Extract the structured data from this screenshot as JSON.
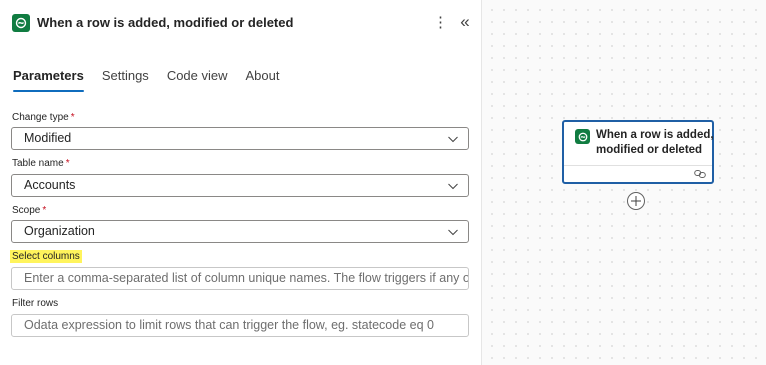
{
  "panel": {
    "title": "When a row is added, modified or deleted",
    "icon": "dataverse-icon",
    "more_icon": "⋮",
    "collapse_icon": "«"
  },
  "tabs": [
    {
      "label": "Parameters",
      "active": true
    },
    {
      "label": "Settings",
      "active": false
    },
    {
      "label": "Code view",
      "active": false
    },
    {
      "label": "About",
      "active": false
    }
  ],
  "fields": {
    "change_type": {
      "label": "Change type",
      "required": "*",
      "value": "Modified"
    },
    "table_name": {
      "label": "Table name",
      "required": "*",
      "value": "Accounts"
    },
    "scope": {
      "label": "Scope",
      "required": "*",
      "value": "Organization"
    },
    "select_columns": {
      "label": "Select columns",
      "placeholder": "Enter a comma-separated list of column unique names. The flow triggers if any of them ar..."
    },
    "filter_rows": {
      "label": "Filter rows",
      "placeholder": "Odata expression to limit rows that can trigger the flow, eg. statecode eq 0"
    }
  },
  "canvas": {
    "card_title": "When a row is added, modified or deleted",
    "card_icon": "dataverse-icon",
    "link_icon": "link-icon",
    "add_icon": "plus-circle-icon"
  },
  "colors": {
    "accent": "#0f6cbd",
    "brand_green": "#107c41",
    "highlight": "#fff45c",
    "required": "#c50f1f",
    "card_border": "#1f5fa5"
  }
}
